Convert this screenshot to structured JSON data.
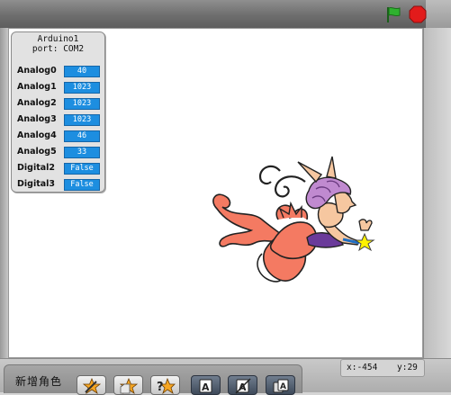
{
  "sensor_board": {
    "title_line1": "Arduino1",
    "title_line2": "port: COM2",
    "rows": [
      {
        "label": "Analog0",
        "value": "40"
      },
      {
        "label": "Analog1",
        "value": "1023"
      },
      {
        "label": "Analog2",
        "value": "1023"
      },
      {
        "label": "Analog3",
        "value": "1023"
      },
      {
        "label": "Analog4",
        "value": "46"
      },
      {
        "label": "Analog5",
        "value": "33"
      },
      {
        "label": "Digital2",
        "value": "False"
      },
      {
        "label": "Digital3",
        "value": "False"
      }
    ]
  },
  "toolbar": {
    "green_flag_icon": "green-flag-icon",
    "stop_icon": "stop-sign-icon",
    "accent_green": "#2fb22f",
    "stop_red": "#e21b1b"
  },
  "bottom": {
    "new_sprite_label": "新增角色",
    "coord_x": "x:-454",
    "coord_y": "y:29",
    "buttons": [
      "paint-new-sprite-icon",
      "choose-sprite-from-file-icon",
      "random-surprise-sprite-icon",
      "turn-sprite-to-left-icon",
      "turn-sprite-to-right-icon",
      "flip-sprite-icon"
    ]
  },
  "stage": {
    "sprite": "fairy-with-wand-sprite"
  }
}
